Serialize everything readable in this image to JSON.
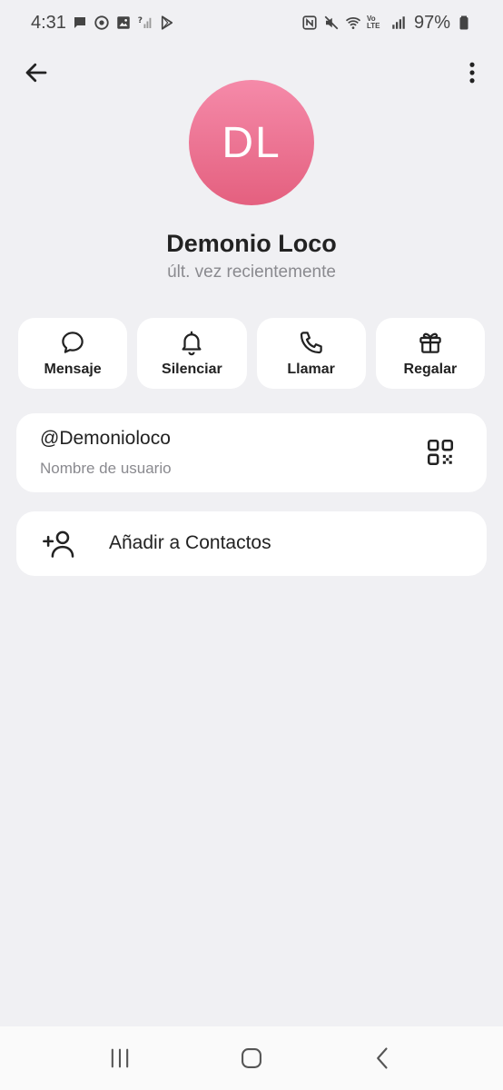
{
  "status_bar": {
    "time": "4:31",
    "battery_percent": "97%",
    "volte_label": "Vo LTE",
    "left_icons": [
      "chat-bubble-icon",
      "target-icon",
      "image-icon",
      "signal-question-icon",
      "play-store-icon"
    ],
    "right_icons": [
      "nfc-icon",
      "mute-icon",
      "wifi-icon",
      "volte-icon",
      "signal-icon",
      "battery-icon"
    ]
  },
  "app_bar": {
    "back_icon": "arrow-left-icon",
    "more_icon": "more-vertical-icon"
  },
  "profile": {
    "initials": "DL",
    "name": "Demonio Loco",
    "status": "últ. vez recientemente",
    "avatar_colors": [
      "#f58aa9",
      "#e4607f"
    ]
  },
  "actions": [
    {
      "label": "Mensaje",
      "icon": "message-icon"
    },
    {
      "label": "Silenciar",
      "icon": "bell-icon"
    },
    {
      "label": "Llamar",
      "icon": "phone-icon"
    },
    {
      "label": "Regalar",
      "icon": "gift-icon"
    }
  ],
  "username": {
    "value": "@Demonioloco",
    "label": "Nombre de usuario",
    "icon": "qr-code-icon"
  },
  "add_contact": {
    "label": "Añadir a Contactos",
    "icon": "add-user-icon"
  },
  "nav_bar": {
    "icons": [
      "recent-apps-icon",
      "home-icon",
      "back-icon"
    ]
  },
  "colors": {
    "background": "#f0f0f3",
    "card": "#ffffff",
    "secondary_text": "#8a8a8f"
  }
}
